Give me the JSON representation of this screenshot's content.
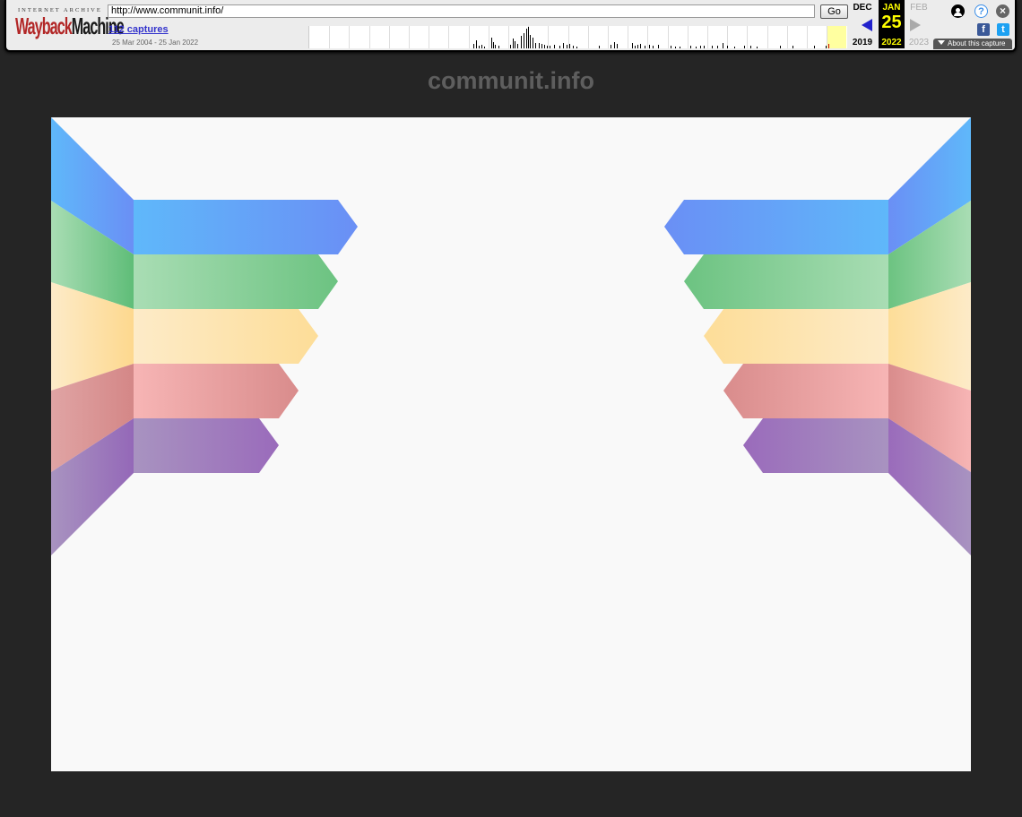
{
  "toolbar": {
    "logo_top": "INTERNET ARCHIVE",
    "logo_wayback": "Wayback",
    "logo_machine": "Machine",
    "url": "http://www.communit.info/",
    "go_label": "Go",
    "captures_label": "112 captures",
    "date_range": "25 Mar 2004 - 25 Jan 2022",
    "prev_month": "DEC",
    "current_month": "JAN",
    "next_month": "FEB",
    "current_day": "25",
    "prev_year": "2019",
    "current_year": "2022",
    "next_year": "2023",
    "about_label": "About this capture",
    "icons": [
      "user-icon",
      "help-icon",
      "close-icon",
      "facebook-icon",
      "twitter-icon"
    ]
  },
  "page": {
    "site_title": "communit.info"
  },
  "colors": {
    "background": "#252525",
    "canvas": "#f9f9f9",
    "title": "#5e5e5e",
    "ribbon_blue": [
      "#5fb8fa",
      "#6a8ff5"
    ],
    "ribbon_green": [
      "#a9ddb4",
      "#6cc381"
    ],
    "ribbon_yellow": [
      "#fdebc8",
      "#fddd98"
    ],
    "ribbon_red": [
      "#f7b5b5",
      "#d98c8c"
    ],
    "ribbon_purple": [
      "#a893c0",
      "#9a6bbb"
    ]
  }
}
